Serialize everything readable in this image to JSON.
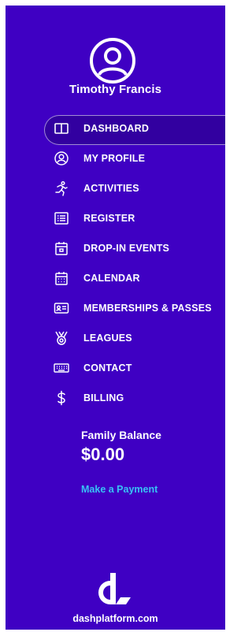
{
  "user": {
    "name": "Timothy Francis",
    "avatar_icon": "user-circle-icon"
  },
  "nav": {
    "items": [
      {
        "label": "DASHBOARD",
        "icon": "dashboard-icon",
        "active": true
      },
      {
        "label": "MY PROFILE",
        "icon": "profile-icon",
        "active": false
      },
      {
        "label": "ACTIVITIES",
        "icon": "running-icon",
        "active": false
      },
      {
        "label": "REGISTER",
        "icon": "list-icon",
        "active": false
      },
      {
        "label": "DROP-IN EVENTS",
        "icon": "calendar-event-icon",
        "active": false
      },
      {
        "label": "CALENDAR",
        "icon": "calendar-icon",
        "active": false
      },
      {
        "label": "MEMBERSHIPS & PASSES",
        "icon": "id-card-icon",
        "active": false
      },
      {
        "label": "LEAGUES",
        "icon": "medal-icon",
        "active": false
      },
      {
        "label": "CONTACT",
        "icon": "keyboard-icon",
        "active": false
      },
      {
        "label": "BILLING",
        "icon": "dollar-icon",
        "active": false
      }
    ]
  },
  "balance": {
    "label": "Family Balance",
    "amount": "$0.00",
    "pay_link": "Make a Payment"
  },
  "brand": {
    "logo_icon": "dash-logo-icon",
    "url_text": "dashplatform.com"
  },
  "colors": {
    "sidebar_bg": "#3f00c3",
    "active_bg": "#3200a0",
    "link": "#38c2f5",
    "text": "#ffffff"
  }
}
